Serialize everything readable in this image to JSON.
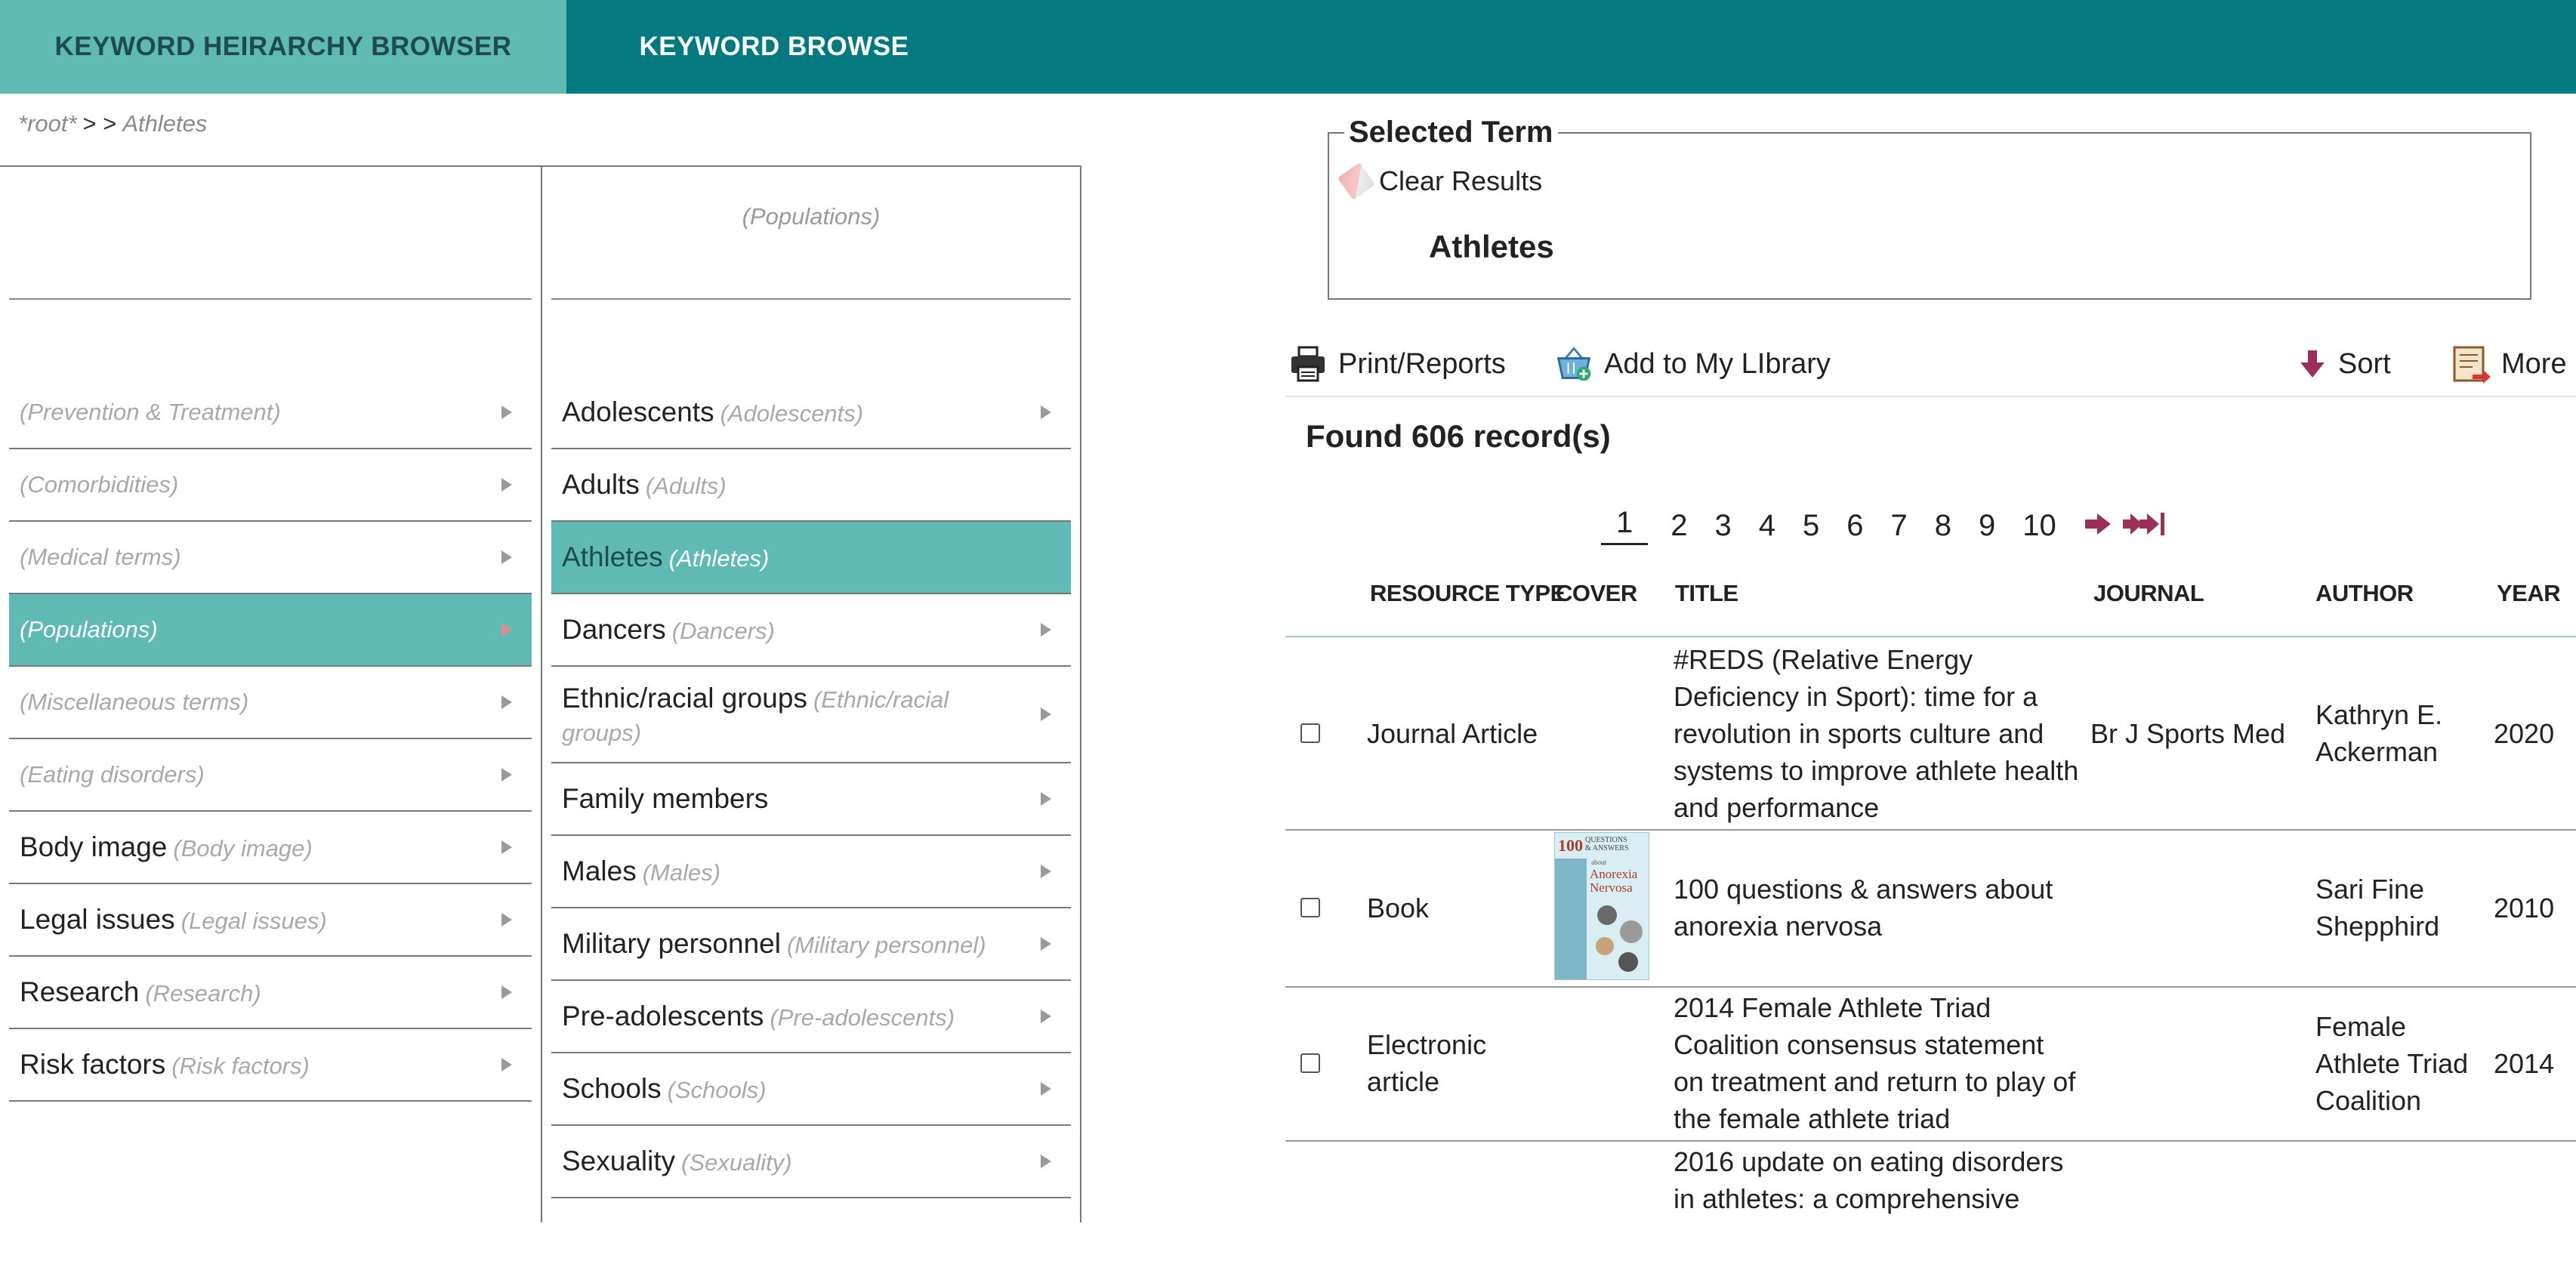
{
  "tabs": [
    {
      "label": "KEYWORD HEIRARCHY BROWSER",
      "active": true
    },
    {
      "label": "KEYWORD BROWSE",
      "active": false
    }
  ],
  "breadcrumb": {
    "root": "*root*",
    "separator": "> >",
    "current": "Athletes"
  },
  "column1": {
    "items": [
      {
        "name": "",
        "alt": "(Prevention & Treatment)"
      },
      {
        "name": "",
        "alt": "(Comorbidities)"
      },
      {
        "name": "",
        "alt": "(Medical terms)"
      },
      {
        "name": "",
        "alt": "(Populations)",
        "selected": true
      },
      {
        "name": "",
        "alt": "(Miscellaneous terms)"
      },
      {
        "name": "",
        "alt": "(Eating disorders)"
      },
      {
        "name": "Body image",
        "alt": "(Body image)"
      },
      {
        "name": "Legal issues",
        "alt": "(Legal issues)"
      },
      {
        "name": "Research",
        "alt": "(Research)"
      },
      {
        "name": "Risk factors",
        "alt": "(Risk factors)"
      }
    ]
  },
  "column2": {
    "title": "(Populations)",
    "items": [
      {
        "name": "Adolescents",
        "alt": "(Adolescents)",
        "arrow": true
      },
      {
        "name": "Adults",
        "alt": "(Adults)",
        "arrow": false
      },
      {
        "name": "Athletes",
        "alt": "(Athletes)",
        "arrow": false,
        "selected": true
      },
      {
        "name": "Dancers",
        "alt": "(Dancers)",
        "arrow": true
      },
      {
        "name": "Ethnic/racial groups",
        "alt": "(Ethnic/racial groups)",
        "arrow": true
      },
      {
        "name": "Family members",
        "alt": "",
        "arrow": true
      },
      {
        "name": "Males",
        "alt": "(Males)",
        "arrow": true
      },
      {
        "name": "Military personnel",
        "alt": "(Military personnel)",
        "arrow": true
      },
      {
        "name": "Pre-adolescents",
        "alt": "(Pre-adolescents)",
        "arrow": true
      },
      {
        "name": "Schools",
        "alt": "(Schools)",
        "arrow": true
      },
      {
        "name": "Sexuality",
        "alt": "(Sexuality)",
        "arrow": true
      }
    ]
  },
  "selected_term": {
    "legend": "Selected Term",
    "clear_label": "Clear Results",
    "term": "Athletes"
  },
  "toolbar": {
    "print": "Print/Reports",
    "library": "Add to My LIbrary",
    "sort": "Sort",
    "more": "More"
  },
  "results": {
    "found_text": "Found 606 record(s)",
    "pages": [
      "1",
      "2",
      "3",
      "4",
      "5",
      "6",
      "7",
      "8",
      "9",
      "10"
    ],
    "current_page": "1",
    "headers": {
      "type": "RESOURCE TYPE",
      "cover": "COVER",
      "title": "TITLE",
      "journal": "JOURNAL",
      "author": "AUTHOR",
      "year": "YEAR"
    },
    "rows": [
      {
        "type": "Journal Article",
        "title": "#REDS (Relative Energy Deficiency in Sport): time for a revolution in sports culture and systems to improve athlete health and performance",
        "journal": "Br J Sports Med",
        "author": "Kathryn E. Ackerman",
        "year": "2020",
        "cover": false
      },
      {
        "type": "Book",
        "title": "100 questions & answers about anorexia nervosa",
        "journal": "",
        "author": "Sari Fine Shepphird",
        "year": "2010",
        "cover": true,
        "cover_text": {
          "number": "100",
          "line1": "QUESTIONS",
          "line2": "& ANSWERS",
          "about": "about",
          "subject1": "Anorexia",
          "subject2": "Nervosa"
        }
      },
      {
        "type": "Electronic article",
        "title": "2014 Female Athlete Triad Coalition consensus statement on treatment and return to play of the female athlete triad",
        "journal": "",
        "author": "Female Athlete Triad Coalition",
        "year": "2014",
        "cover": false
      },
      {
        "type": "",
        "title": "2016 update on eating disorders in athletes: a comprehensive",
        "journal": "",
        "author": "",
        "year": "",
        "cover": false
      }
    ]
  },
  "colors": {
    "accent": "#047a80",
    "accent_light": "#5fb9b5"
  }
}
